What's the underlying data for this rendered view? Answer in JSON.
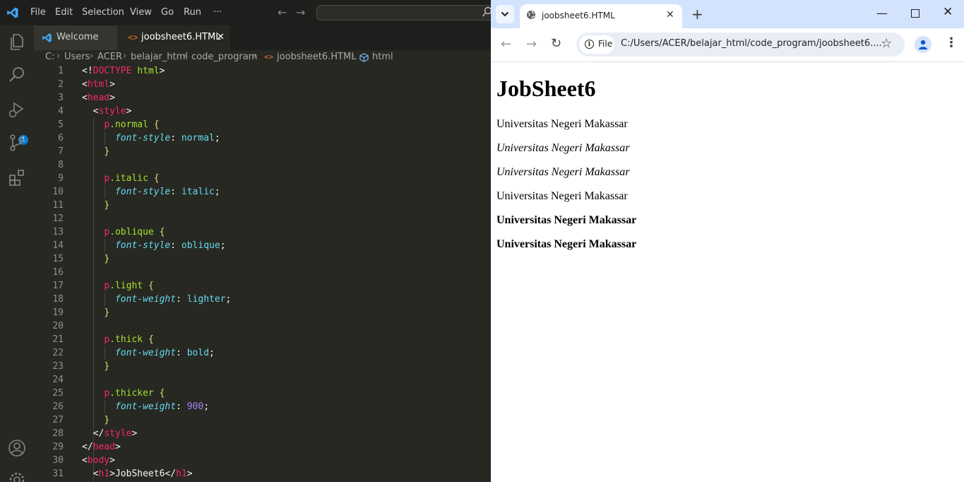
{
  "vscode": {
    "menu": [
      "File",
      "Edit",
      "Selection",
      "View",
      "Go",
      "Run",
      "···"
    ],
    "activity_badge": "1",
    "tabs": [
      {
        "label": "Welcome"
      },
      {
        "label": "joobsheet6.HTML",
        "close": "✕"
      }
    ],
    "breadcrumb": [
      "C:",
      "Users",
      "ACER",
      "belajar_html",
      "code_program",
      "joobsheet6.HTML",
      "html"
    ],
    "code_lines": [
      [
        [
          "br",
          "<!"
        ],
        [
          "tag",
          "DOCTYPE"
        ],
        [
          "br",
          " "
        ],
        [
          "attr",
          "html"
        ],
        [
          "br",
          ">"
        ]
      ],
      [
        [
          "br",
          "<"
        ],
        [
          "tag",
          "html"
        ],
        [
          "br",
          ">"
        ]
      ],
      [
        [
          "br",
          "<"
        ],
        [
          "tag",
          "head"
        ],
        [
          "br",
          ">"
        ]
      ],
      [
        [
          "br",
          "  <"
        ],
        [
          "tag",
          "style"
        ],
        [
          "br",
          ">"
        ]
      ],
      [
        [
          "br",
          "    "
        ],
        [
          "tag",
          "p"
        ],
        [
          "attr",
          ".normal"
        ],
        [
          "br",
          " "
        ],
        [
          "brace",
          "{"
        ]
      ],
      [
        [
          "br",
          "      "
        ],
        [
          "prop",
          "font-style"
        ],
        [
          "br",
          ": "
        ],
        [
          "val",
          "normal"
        ],
        [
          "br",
          ";"
        ]
      ],
      [
        [
          "br",
          "    "
        ],
        [
          "brace",
          "}"
        ]
      ],
      [],
      [
        [
          "br",
          "    "
        ],
        [
          "tag",
          "p"
        ],
        [
          "attr",
          ".italic"
        ],
        [
          "br",
          " "
        ],
        [
          "brace",
          "{"
        ]
      ],
      [
        [
          "br",
          "      "
        ],
        [
          "prop",
          "font-style"
        ],
        [
          "br",
          ": "
        ],
        [
          "val",
          "italic"
        ],
        [
          "br",
          ";"
        ]
      ],
      [
        [
          "br",
          "    "
        ],
        [
          "brace",
          "}"
        ]
      ],
      [],
      [
        [
          "br",
          "    "
        ],
        [
          "tag",
          "p"
        ],
        [
          "attr",
          ".oblique"
        ],
        [
          "br",
          " "
        ],
        [
          "brace",
          "{"
        ]
      ],
      [
        [
          "br",
          "      "
        ],
        [
          "prop",
          "font-style"
        ],
        [
          "br",
          ": "
        ],
        [
          "val",
          "oblique"
        ],
        [
          "br",
          ";"
        ]
      ],
      [
        [
          "br",
          "    "
        ],
        [
          "brace",
          "}"
        ]
      ],
      [],
      [
        [
          "br",
          "    "
        ],
        [
          "tag",
          "p"
        ],
        [
          "attr",
          ".light"
        ],
        [
          "br",
          " "
        ],
        [
          "brace",
          "{"
        ]
      ],
      [
        [
          "br",
          "      "
        ],
        [
          "prop",
          "font-weight"
        ],
        [
          "br",
          ": "
        ],
        [
          "val",
          "lighter"
        ],
        [
          "br",
          ";"
        ]
      ],
      [
        [
          "br",
          "    "
        ],
        [
          "brace",
          "}"
        ]
      ],
      [],
      [
        [
          "br",
          "    "
        ],
        [
          "tag",
          "p"
        ],
        [
          "attr",
          ".thick"
        ],
        [
          "br",
          " "
        ],
        [
          "brace",
          "{"
        ]
      ],
      [
        [
          "br",
          "      "
        ],
        [
          "prop",
          "font-weight"
        ],
        [
          "br",
          ": "
        ],
        [
          "val",
          "bold"
        ],
        [
          "br",
          ";"
        ]
      ],
      [
        [
          "br",
          "    "
        ],
        [
          "brace",
          "}"
        ]
      ],
      [],
      [
        [
          "br",
          "    "
        ],
        [
          "tag",
          "p"
        ],
        [
          "attr",
          ".thicker"
        ],
        [
          "br",
          " "
        ],
        [
          "brace",
          "{"
        ]
      ],
      [
        [
          "br",
          "      "
        ],
        [
          "prop",
          "font-weight"
        ],
        [
          "br",
          ": "
        ],
        [
          "num",
          "900"
        ],
        [
          "br",
          ";"
        ]
      ],
      [
        [
          "br",
          "    "
        ],
        [
          "brace",
          "}"
        ]
      ],
      [
        [
          "br",
          "  </"
        ],
        [
          "tag",
          "style"
        ],
        [
          "br",
          ">"
        ]
      ],
      [
        [
          "br",
          "</"
        ],
        [
          "tag",
          "head"
        ],
        [
          "br",
          ">"
        ]
      ],
      [
        [
          "br",
          "<"
        ],
        [
          "tag",
          "body"
        ],
        [
          "br",
          ">"
        ]
      ],
      [
        [
          "br",
          "  <"
        ],
        [
          "tag",
          "h1"
        ],
        [
          "br",
          ">"
        ],
        [
          "txt",
          "JobSheet6"
        ],
        [
          "br",
          "</"
        ],
        [
          "tag",
          "h1"
        ],
        [
          "br",
          ">"
        ]
      ]
    ]
  },
  "chrome": {
    "tab_title": "joobsheet6.HTML",
    "tab_close": "✕",
    "new_tab": "+",
    "file_chip": "File",
    "url": "C:/Users/ACER/belajar_html/code_program/joobsheet6....",
    "page": {
      "heading": "JobSheet6",
      "paragraphs": [
        {
          "text": "Universitas Negeri Makassar",
          "style": "normal"
        },
        {
          "text": "Universitas Negeri Makassar",
          "style": "italic"
        },
        {
          "text": "Universitas Negeri Makassar",
          "style": "oblique"
        },
        {
          "text": "Universitas Negeri Makassar",
          "style": "light"
        },
        {
          "text": "Universitas Negeri Makassar",
          "style": "thick"
        },
        {
          "text": "Universitas Negeri Makassar",
          "style": "thicker"
        }
      ]
    }
  },
  "colors": {
    "vscode_editor_bg": "#272822",
    "vscode_titlebar_bg": "#1e1f1c",
    "tag": "#f92672",
    "attr": "#a6e22e",
    "prop": "#66d9ef",
    "brace": "#e6db74",
    "number": "#ae81ff",
    "chrome_tabstrip": "#d3e3fd"
  }
}
